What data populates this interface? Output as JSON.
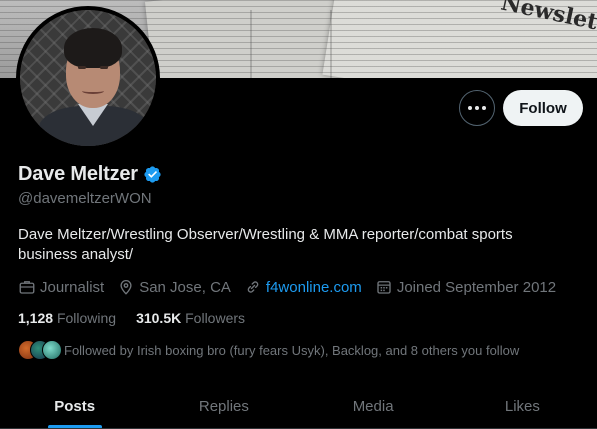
{
  "profile": {
    "display_name": "Dave Meltzer",
    "handle": "@davemeltzerWON",
    "verified": true,
    "bio": "Dave Meltzer/Wrestling Observer/Wrestling & MMA reporter/combat sports business analyst/"
  },
  "banner": {
    "headline": "Newslette"
  },
  "actions": {
    "follow_label": "Follow",
    "more_icon": "more-horizontal-icon"
  },
  "meta": {
    "category": "Journalist",
    "location": "San Jose, CA",
    "website": "f4wonline.com",
    "joined": "Joined September 2012"
  },
  "stats": {
    "following_count": "1,128",
    "following_label": "Following",
    "followers_count": "310.5K",
    "followers_label": "Followers"
  },
  "followed_by": {
    "text": "Followed by Irish boxing bro (fury fears Usyk), Backlog, and 8 others you follow"
  },
  "tabs": [
    {
      "label": "Posts",
      "active": true
    },
    {
      "label": "Replies",
      "active": false
    },
    {
      "label": "Media",
      "active": false
    },
    {
      "label": "Likes",
      "active": false
    }
  ],
  "colors": {
    "background": "#000000",
    "accent": "#1d9bf0",
    "text_primary": "#e7e9ea",
    "text_secondary": "#71767b",
    "follow_button_bg": "#eff3f4"
  }
}
